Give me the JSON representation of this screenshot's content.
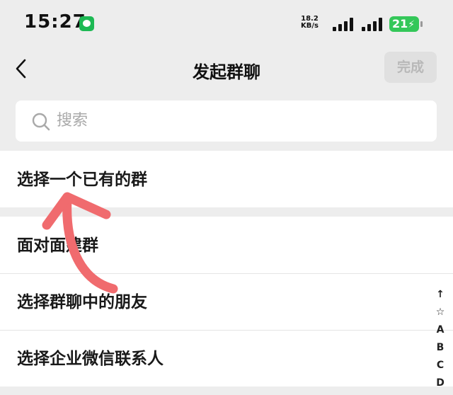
{
  "status_bar": {
    "time": "15:27",
    "net_speed_value": "18.2",
    "net_speed_unit": "KB/s",
    "battery": "21"
  },
  "nav": {
    "title": "发起群聊",
    "done_label": "完成"
  },
  "search": {
    "placeholder": "搜索"
  },
  "existing_group": {
    "label": "选择一个已有的群"
  },
  "options": [
    {
      "label": "面对面建群"
    },
    {
      "label": "选择群聊中的朋友"
    },
    {
      "label": "选择企业微信联系人"
    }
  ],
  "index_bar": [
    "↑",
    "☆",
    "A",
    "B",
    "C",
    "D"
  ],
  "colors": {
    "annotation_arrow": "#f06b6e",
    "battery": "#34c759",
    "background": "#ededed"
  }
}
